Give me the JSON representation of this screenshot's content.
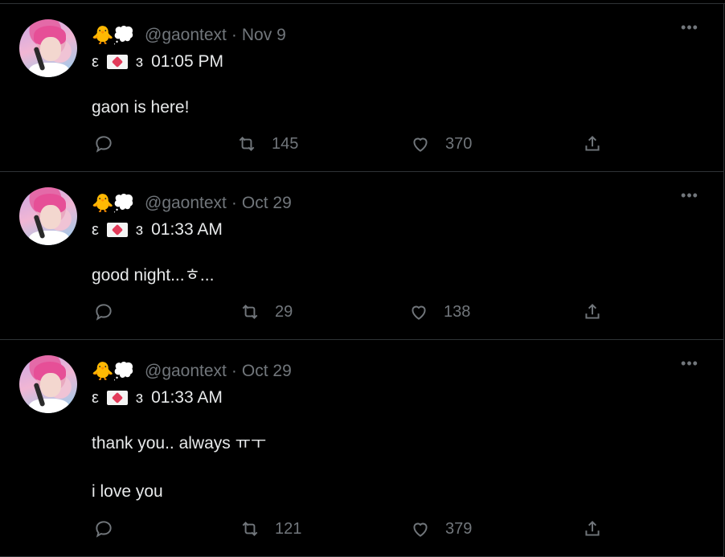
{
  "tweets": [
    {
      "handle": "@gaontext",
      "dot": "·",
      "date": "Nov 9",
      "bracket_left": "ε",
      "bracket_right": "ɜ",
      "time": "01:05 PM",
      "text": "gaon is here!",
      "retweets": "145",
      "likes": "370"
    },
    {
      "handle": "@gaontext",
      "dot": "·",
      "date": "Oct 29",
      "bracket_left": "ε",
      "bracket_right": "ɜ",
      "time": "01:33 AM",
      "text": "good night...ㅎ...",
      "retweets": "29",
      "likes": "138"
    },
    {
      "handle": "@gaontext",
      "dot": "·",
      "date": "Oct 29",
      "bracket_left": "ε",
      "bracket_right": "ɜ",
      "time": "01:33 AM",
      "text": "thank you.. always ㅠㅜ\n\ni love you",
      "retweets": "121",
      "likes": "379"
    }
  ],
  "ui": {
    "more": "•••",
    "chick_emoji": "🐥",
    "cloud_emoji": "💭"
  },
  "colors": {
    "background": "#000000",
    "text": "#e7e9ea",
    "muted": "#71767b",
    "border": "#2f3336"
  }
}
